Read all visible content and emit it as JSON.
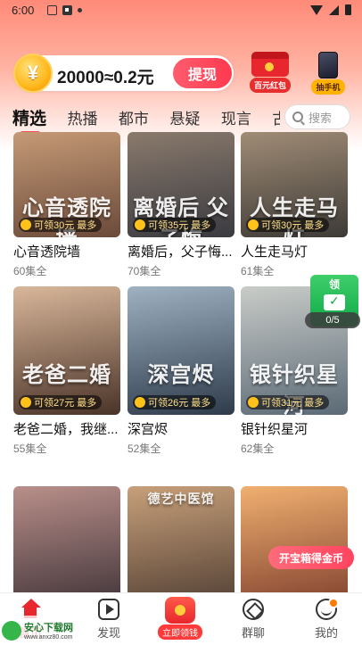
{
  "status_bar": {
    "time": "6:00"
  },
  "coins": {
    "rate_text": "20000≈0.2元",
    "coin_symbol": "¥",
    "withdraw_label": "提现"
  },
  "promos": [
    {
      "label": "百元红包",
      "icon": "red-envelope-icon"
    },
    {
      "label": "抽手机",
      "icon": "phone-prize-icon"
    }
  ],
  "tabs": [
    "精选",
    "热播",
    "都市",
    "悬疑",
    "现言",
    "古"
  ],
  "active_tab": "精选",
  "search": {
    "placeholder": "搜索"
  },
  "dramas": [
    {
      "title": "心音透院墙",
      "episodes": "60集全",
      "reward": "可领30元 最多",
      "poster_text": "心音透院墙",
      "colors": [
        "#6b4a3a",
        "#c59a76"
      ]
    },
    {
      "title": "离婚后，父子悔...",
      "episodes": "70集全",
      "reward": "可领35元 最多",
      "poster_text": "离婚后 父子悔",
      "colors": [
        "#3a3a40",
        "#8a7a6c"
      ]
    },
    {
      "title": "人生走马灯",
      "episodes": "61集全",
      "reward": "可领30元 最多",
      "poster_text": "人生走马灯",
      "colors": [
        "#3d3a36",
        "#a08c76"
      ]
    },
    {
      "title": "老爸二婚，我继...",
      "episodes": "55集全",
      "reward": "可领27元 最多",
      "poster_text": "老爸二婚",
      "colors": [
        "#4a3328",
        "#d9b79a"
      ]
    },
    {
      "title": "深宫烬",
      "episodes": "52集全",
      "reward": "可领26元 最多",
      "poster_text": "深宫烬",
      "colors": [
        "#2e3b4a",
        "#9fb2c2"
      ]
    },
    {
      "title": "银针织星河",
      "episodes": "62集全",
      "reward": "可领31元 最多",
      "poster_text": "银针织星河",
      "colors": [
        "#5b6a76",
        "#c9ccc8"
      ]
    },
    {
      "title": "",
      "episodes": "",
      "reward": "",
      "poster_text": "",
      "colors": [
        "#3a2f34",
        "#b98f8a"
      ]
    },
    {
      "title": "",
      "episodes": "",
      "reward": "",
      "poster_text": "德艺中医馆",
      "colors": [
        "#4b3a30",
        "#c8a07a"
      ]
    },
    {
      "title": "",
      "episodes": "",
      "reward": "",
      "poster_text": "",
      "colors": [
        "#7a3a2a",
        "#f0b070"
      ]
    }
  ],
  "floating": {
    "claim_label": "领",
    "progress": "0/5",
    "treasure_label": "开宝箱得金币"
  },
  "nav": {
    "home": "首页",
    "discover": "发现",
    "cash": "立即领钱",
    "group": "群聊",
    "me": "我的"
  },
  "watermark": {
    "text": "安心下载网",
    "url": "www.anxz80.com"
  }
}
